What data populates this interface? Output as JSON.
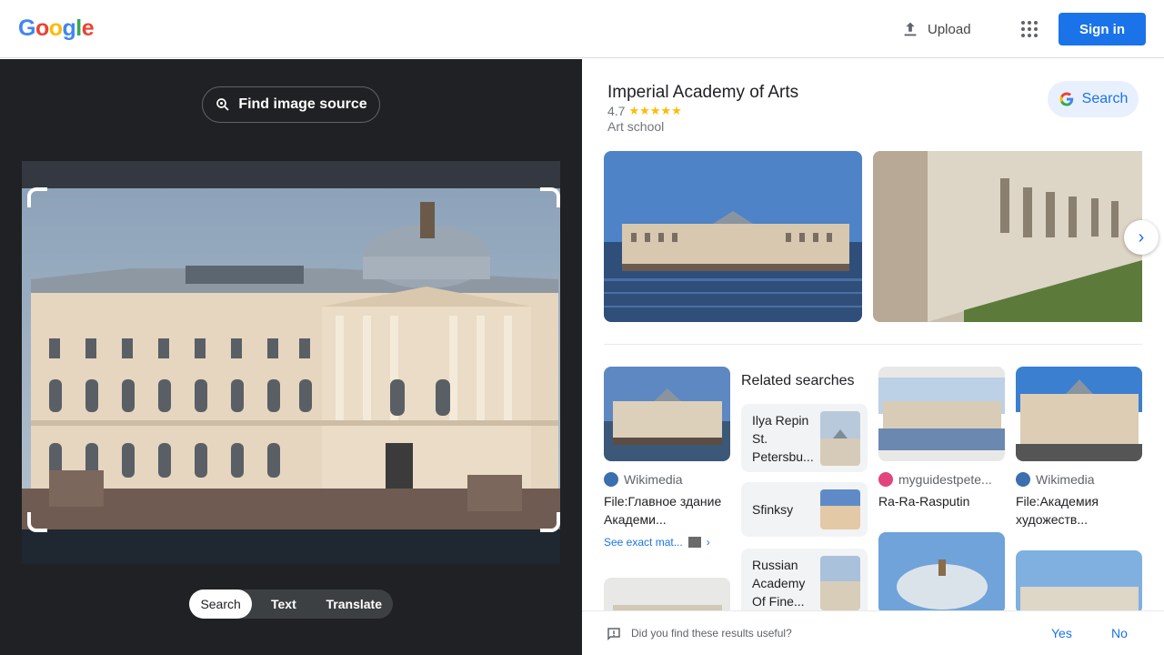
{
  "header": {
    "logo_letters": [
      "G",
      "o",
      "o",
      "g",
      "l",
      "e"
    ],
    "upload_label": "Upload",
    "apps_icon": "apps-grid-icon",
    "signin_label": "Sign in"
  },
  "left_panel": {
    "find_source_label": "Find image source",
    "modes": [
      "Search",
      "Text",
      "Translate"
    ],
    "active_mode": "Search"
  },
  "knowledge_panel": {
    "title": "Imperial Academy of Arts",
    "rating": "4.7",
    "stars": "★★★★★",
    "subtitle": "Art school",
    "search_button": "Search"
  },
  "results": {
    "related_heading": "Related searches",
    "related": [
      {
        "label": "Ilya Repin St. Petersbu..."
      },
      {
        "label": "Sfinksy"
      },
      {
        "label": "Russian Academy Of Fine..."
      }
    ],
    "cards": [
      {
        "source": "Wikimedia",
        "caption": "File:Главное здание Академи...",
        "exact": "See exact mat..."
      },
      {
        "source": "myguidestpete...",
        "caption": "Ra-Ra-Rasputin"
      },
      {
        "source": "Wikimedia",
        "caption": "File:Академия художеств..."
      }
    ]
  },
  "feedback": {
    "question": "Did you find these results useful?",
    "yes": "Yes",
    "no": "No"
  },
  "colors": {
    "accent": "#1a73e8",
    "dark_bg": "#202124",
    "star": "#fbbc04"
  }
}
